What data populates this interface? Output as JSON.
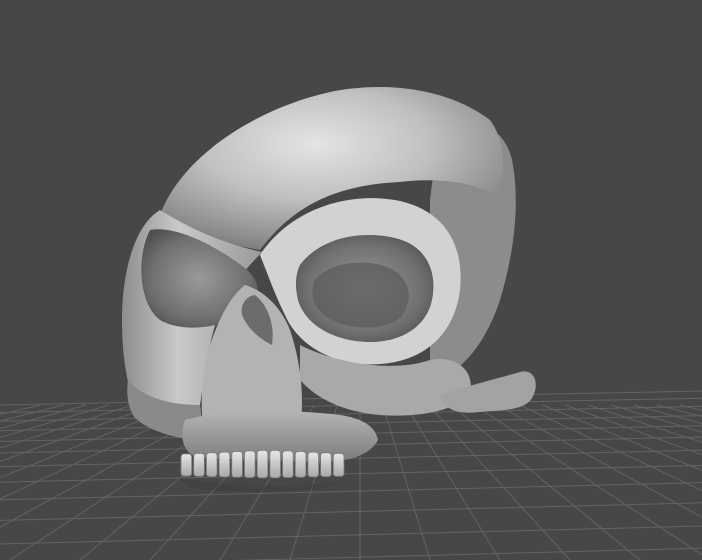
{
  "viewport": {
    "background": "#474747",
    "grid_color": "#6a6a6a",
    "model_color": "#bdbdbd",
    "model": "skull"
  }
}
